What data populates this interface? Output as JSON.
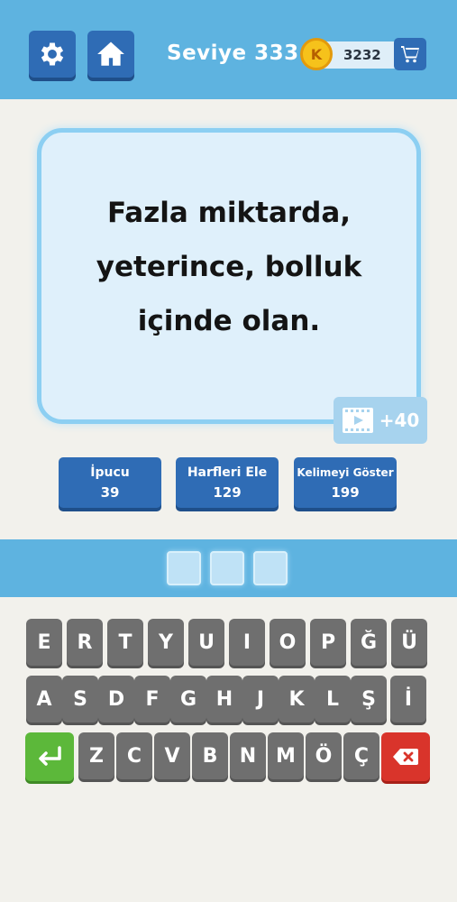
{
  "header": {
    "level_text": "Seviye 333",
    "coin_letter": "K",
    "coins": "3232",
    "colors": {
      "bar": "#5eb3e0",
      "button": "#2f6cb5",
      "coin": "#f6c21b"
    },
    "icons": {
      "settings": "gear-icon",
      "home": "home-icon",
      "shop": "cart-icon"
    }
  },
  "question": {
    "line1": "Fazla miktarda,",
    "line2": "yeterince, bolluk",
    "line3": "içinde olan."
  },
  "video_reward": {
    "label": "+40",
    "icon": "film-icon"
  },
  "helpers": {
    "hint": {
      "label": "İpucu",
      "cost": "39"
    },
    "eliminate": {
      "label": "Harfleri Ele",
      "cost": "129"
    },
    "reveal": {
      "label": "Kelimeyi Göster",
      "cost": "199"
    }
  },
  "answer": {
    "slot_count": 3
  },
  "keyboard": {
    "row1": [
      "E",
      "R",
      "T",
      "Y",
      "U",
      "I",
      "O",
      "P",
      "Ğ",
      "Ü"
    ],
    "row2": [
      "A",
      "S",
      "D",
      "F",
      "G",
      "H",
      "J",
      "K",
      "L",
      "Ş",
      "İ"
    ],
    "row3": [
      "Z",
      "C",
      "V",
      "B",
      "N",
      "M",
      "Ö",
      "Ç"
    ],
    "colors": {
      "key": "#6f6f6f",
      "enter": "#5cb83a",
      "delete": "#d9342b"
    }
  }
}
